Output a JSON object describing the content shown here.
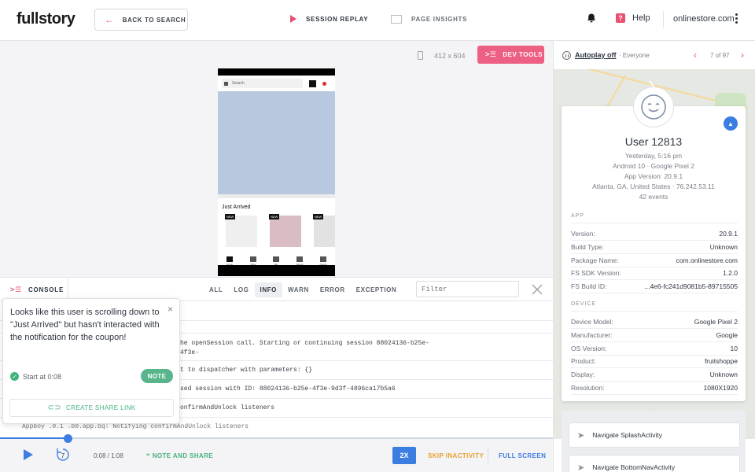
{
  "header": {
    "logo": "fullstory",
    "back_label": "BACK TO SEARCH",
    "tabs": [
      {
        "label": "SESSION REPLAY",
        "active": true
      },
      {
        "label": "PAGE INSIGHTS",
        "active": false
      }
    ],
    "help_label": "Help",
    "org": "onlinestore.com"
  },
  "player": {
    "dimensions": "412 x 604",
    "devtools_label": "DEV TOOLS",
    "phone": {
      "search_placeholder": "Search",
      "section_title": "Just Arrived",
      "badge": "NEW",
      "product_colors": [
        "#efefef",
        "#d9bcc4",
        "#e2e2e2"
      ],
      "nav": [
        "Home",
        "Shop",
        "Me",
        "Stores",
        "Inspire"
      ]
    }
  },
  "console": {
    "label": "CONSOLE",
    "filters": [
      "ALL",
      "LOG",
      "INFO",
      "WARN",
      "ERROR",
      "EXCEPTION"
    ],
    "active_filter": "INFO",
    "filter_placeholder": "Filter",
    "logs": [
      "he openSession call. Starting or continuing session 88024136-b25e-4f3e-",
      "t to dispatcher with parameters: {}",
      "sed session with ID: 88024136-b25e-4f3e-9d3f-4896ca17b5a6",
      "onfirmAndUnlock listeners",
      "Appboy    .0.1 .b0.app.bq: Notifying confirmAndUnlock listeners"
    ]
  },
  "note_popup": {
    "text": "Looks like this user is scrolling down to \"Just Arrived\" but hasn't interacted with the notification for the coupon!",
    "start": "Start at 0:08",
    "note_button": "NOTE",
    "share_link": "CREATE SHARE LINK"
  },
  "playback": {
    "time": "0:08 / 1:08",
    "progress": 0.123,
    "note_and_share": "NOTE AND SHARE",
    "speed": "2X",
    "skip_label": "SKIP INACTIVITY",
    "fullscreen_label": "FULL SCREEN",
    "rewind_seconds": "7"
  },
  "sidebar": {
    "autoplay": "Autoplay off",
    "audience": "· Everyone",
    "count": "7 of 97",
    "user": {
      "name": "User 12813",
      "time": "Yesterday, 5:16 pm",
      "device": "Android 10 · Google Pixel 2",
      "app_version": "App Version: 20.9.1",
      "location": "Atlanta, GA, United States · 76.242.53.11",
      "events": "42 events"
    },
    "app_section": "APP",
    "app": [
      {
        "k": "Version:",
        "v": "20.9.1"
      },
      {
        "k": "Build Type:",
        "v": "Unknown"
      },
      {
        "k": "Package Name:",
        "v": "com.onlinestore.com"
      },
      {
        "k": "FS SDK Version:",
        "v": "1.2.0"
      },
      {
        "k": "FS Build ID:",
        "v": "...4e6-fc241d9081b5-89715505"
      }
    ],
    "device_section": "DEVICE",
    "device": [
      {
        "k": "Device Model:",
        "v": "Google Pixel 2"
      },
      {
        "k": "Manufacturer:",
        "v": "Google"
      },
      {
        "k": "OS Version:",
        "v": "10"
      },
      {
        "k": "Product:",
        "v": "fruitshoppe"
      },
      {
        "k": "Display:",
        "v": "Unknown"
      },
      {
        "k": "Resolution:",
        "v": "1080X1920"
      }
    ],
    "event_list": [
      "Navigate SplashActivity",
      "Navigate BottomNavActivity"
    ]
  },
  "colors": {
    "accent_pink": "#e8506e",
    "accent_blue": "#3b7de0",
    "accent_green": "#44b27f",
    "accent_orange": "#e8a12c"
  }
}
